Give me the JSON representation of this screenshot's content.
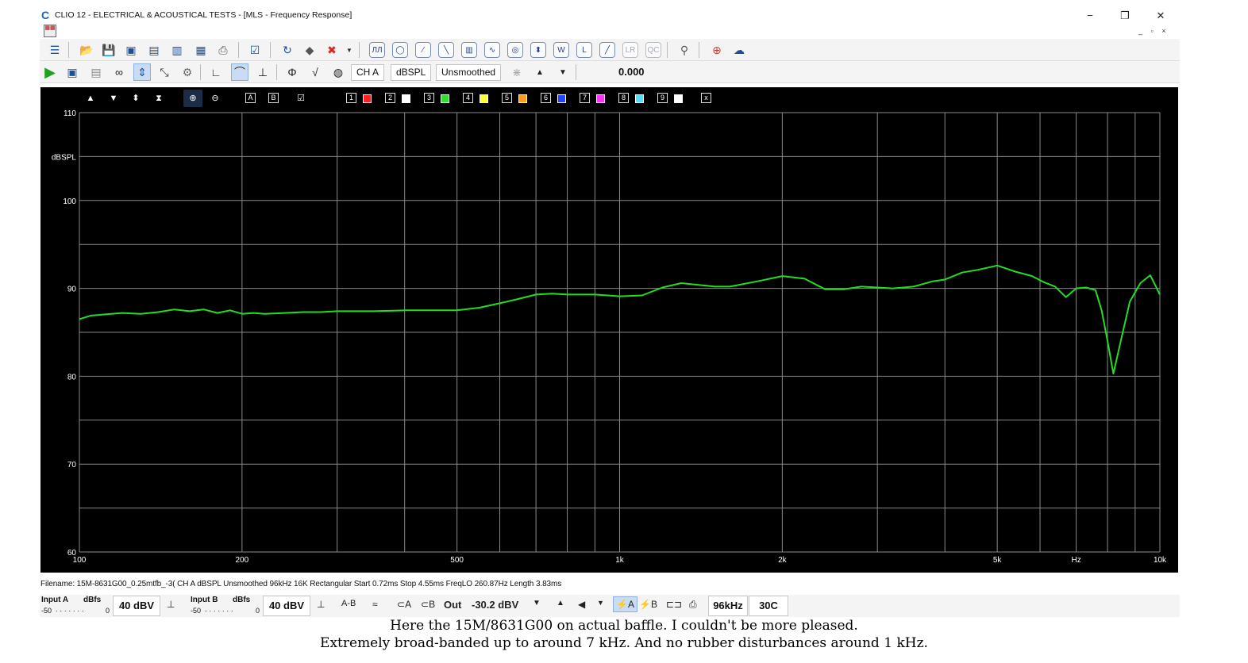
{
  "window": {
    "title": "CLIO 12 - ELECTRICAL & ACOUSTICAL TESTS - [MLS - Frequency Response]",
    "logo": "C",
    "minimize": "−",
    "restore": "❐",
    "close": "✕",
    "mdi": "_ ▫ ×"
  },
  "toolbar2": {
    "channel": "CH A",
    "units": "dBSPL",
    "smoothing": "Unsmoothed",
    "value": "0.000"
  },
  "chart_tools": {
    "overlays": [
      "1",
      "2",
      "3",
      "4",
      "5",
      "6",
      "7",
      "8",
      "9"
    ],
    "overlay_colors": [
      "#ff2020",
      "#ffffff",
      "#33dd33",
      "#ffff33",
      "#ff9922",
      "#2244ff",
      "#ff33ff",
      "#55ddff",
      "#ffffff"
    ],
    "box_a": "A",
    "box_b": "B",
    "close": "x"
  },
  "status_line": "Filename: 15M-8631G00_0.25mtfb_-3( CH A   dBSPL   Unsmoothed   96kHz   16K   Rectangular   Start 0.72ms    Stop 4.55ms    FreqLO 260.87Hz    Length 3.83ms",
  "bottom": {
    "input_a": "Input A",
    "input_b": "Input B",
    "dbfs": "dBfs",
    "scale_left": "-50",
    "scale_right": "0",
    "input_a_range": "40 dBV",
    "input_b_range": "40 dBV",
    "a_minus_b": "A-B",
    "out_label": "Out",
    "out_level": "-30.2 dBV",
    "ca": "A",
    "cb": "B",
    "sample_rate": "96kHz",
    "temperature": "30C"
  },
  "caption": {
    "line1": "Here the 15M/8631G00 on actual baffle.  I couldn't be more pleased.",
    "line2": "Extremely broad-banded up to around 7 kHz. And no rubber disturbances around 1 kHz."
  },
  "chart_data": {
    "type": "line",
    "title": "",
    "xlabel": "Hz",
    "ylabel": "dBSPL",
    "x_scale": "log",
    "xlim": [
      100,
      10000
    ],
    "ylim": [
      60,
      110
    ],
    "y_ticks": [
      60,
      70,
      80,
      90,
      100,
      110
    ],
    "x_tick_labels": [
      {
        "value": 100,
        "label": "100"
      },
      {
        "value": 200,
        "label": "200"
      },
      {
        "value": 500,
        "label": "500"
      },
      {
        "value": 1000,
        "label": "1k"
      },
      {
        "value": 2000,
        "label": "2k"
      },
      {
        "value": 5000,
        "label": "5k"
      },
      {
        "value": 7000,
        "label": "Hz"
      },
      {
        "value": 10000,
        "label": "10k"
      }
    ],
    "grid": true,
    "background": "#000000",
    "grid_color": "#8a8a8a",
    "series": [
      {
        "color": "#22dd22",
        "x": [
          100,
          105,
          110,
          120,
          130,
          140,
          150,
          160,
          170,
          180,
          190,
          200,
          210,
          220,
          240,
          260,
          280,
          300,
          350,
          400,
          450,
          500,
          550,
          600,
          650,
          700,
          750,
          800,
          900,
          1000,
          1100,
          1200,
          1300,
          1400,
          1500,
          1600,
          1800,
          2000,
          2200,
          2400,
          2600,
          2800,
          3000,
          3200,
          3500,
          3800,
          4000,
          4300,
          4600,
          5000,
          5400,
          5800,
          6100,
          6400,
          6700,
          7000,
          7300,
          7600,
          7800,
          8000,
          8200,
          8500,
          8800,
          9200,
          9600,
          10000
        ],
        "y": [
          86.5,
          86.9,
          87.0,
          87.2,
          87.1,
          87.3,
          87.6,
          87.4,
          87.6,
          87.2,
          87.5,
          87.1,
          87.2,
          87.1,
          87.2,
          87.3,
          87.3,
          87.4,
          87.4,
          87.5,
          87.5,
          87.5,
          87.8,
          88.3,
          88.8,
          89.3,
          89.4,
          89.3,
          89.3,
          89.1,
          89.2,
          90.1,
          90.6,
          90.4,
          90.2,
          90.2,
          90.8,
          91.4,
          91.1,
          89.9,
          89.9,
          90.2,
          90.1,
          90.0,
          90.2,
          90.8,
          91.0,
          91.8,
          92.1,
          92.6,
          91.9,
          91.4,
          90.7,
          90.2,
          89.0,
          90.0,
          90.1,
          89.8,
          87.5,
          84.0,
          80.3,
          84.5,
          88.5,
          90.6,
          91.5,
          89.3
        ]
      }
    ]
  }
}
